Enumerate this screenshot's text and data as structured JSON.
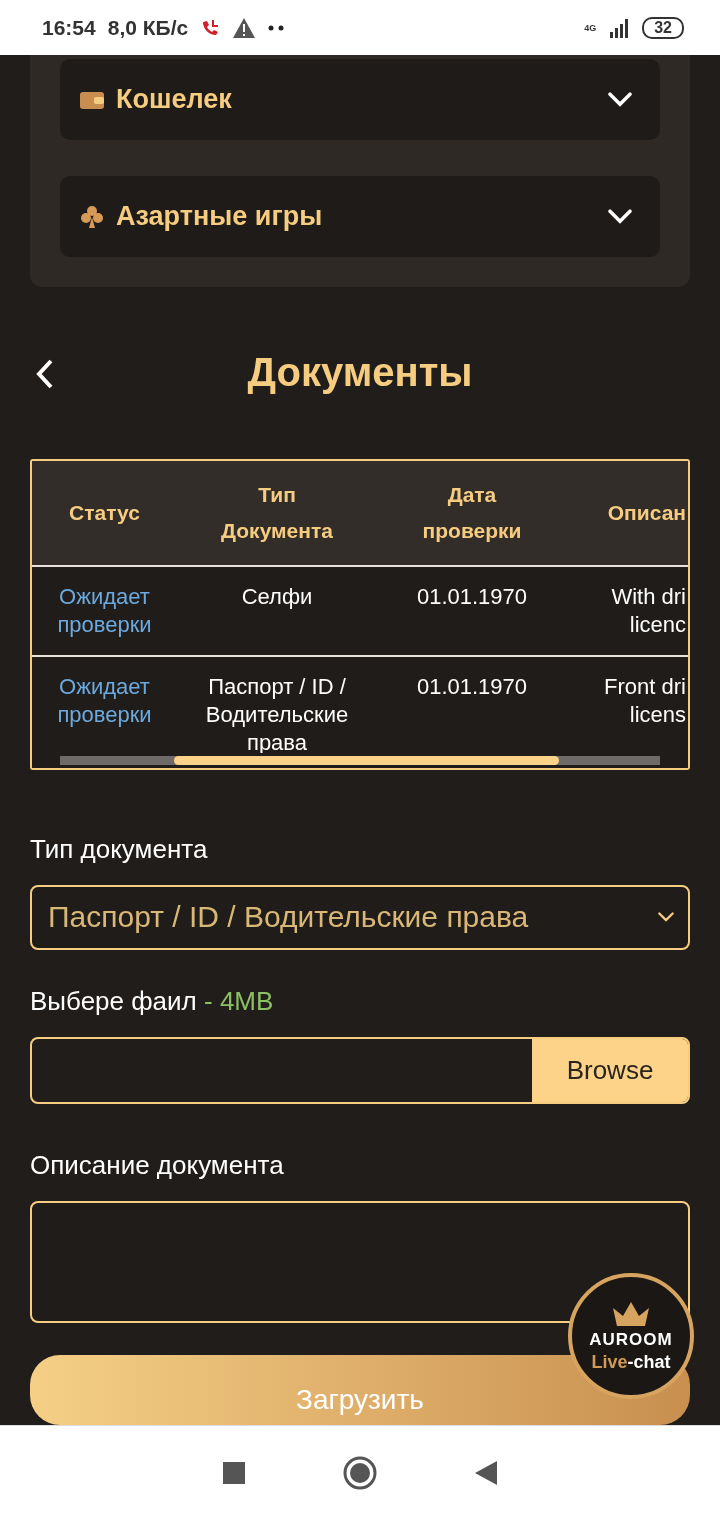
{
  "status_bar": {
    "time": "16:54",
    "speed": "8,0 КБ/с",
    "network": "4G",
    "battery": "32"
  },
  "accordions": [
    {
      "label": "Кошелек",
      "kind": "wallet",
      "expanded": false
    },
    {
      "label": "Азартные игры",
      "kind": "clubs",
      "expanded": false
    }
  ],
  "title": "Документы",
  "table": {
    "columns": [
      [
        "Статус"
      ],
      [
        "Тип",
        "Документа"
      ],
      [
        "Дата",
        "проверки"
      ],
      [
        "Описан"
      ]
    ],
    "rows": [
      {
        "status": [
          "Ожидает",
          "проверки"
        ],
        "type": [
          "Селфи"
        ],
        "date": "01.01.1970",
        "description": [
          "With dri",
          "licenc"
        ]
      },
      {
        "status": [
          "Ожидает",
          "проверки"
        ],
        "type": [
          "Паспорт / ID /",
          "Водительские",
          "права"
        ],
        "date": "01.01.1970",
        "description": [
          "Front dri",
          "licens"
        ]
      }
    ]
  },
  "form": {
    "type_label": "Тип документа",
    "type_value": "Паспорт / ID / Водительские права",
    "file_label": "Выбере фаил",
    "file_hint": "- 4MB",
    "browse": "Browse",
    "description_label": "Описание документа",
    "upload": "Загрузить"
  },
  "chat": {
    "brand": "AUROOM",
    "live": "Live",
    "chat": "-chat"
  }
}
